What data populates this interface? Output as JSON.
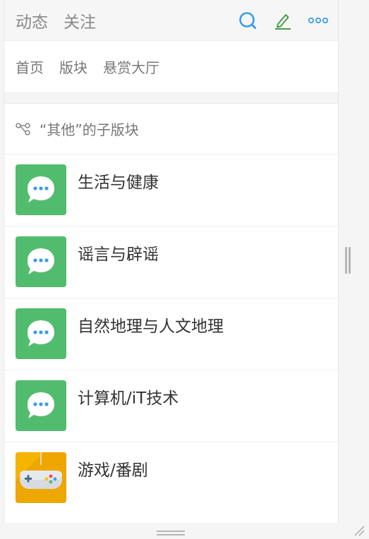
{
  "topbar": {
    "tabs": [
      "动态",
      "关注"
    ],
    "icons": [
      "search-icon",
      "edit-icon",
      "more-icon"
    ],
    "accent_blue": "#3a9ee8",
    "accent_green": "#52bc6e"
  },
  "nav": {
    "items": [
      "首页",
      "版块",
      "悬赏大厅"
    ]
  },
  "section": {
    "title": "“其他”的子版块",
    "icon": "subboard-icon"
  },
  "boards": [
    {
      "name": "生活与健康",
      "icon": "chat-bubble-icon"
    },
    {
      "name": "谣言与辟谣",
      "icon": "chat-bubble-icon"
    },
    {
      "name": "自然地理与人文地理",
      "icon": "chat-bubble-icon"
    },
    {
      "name": "计算机/iT技术",
      "icon": "chat-bubble-icon"
    },
    {
      "name": "游戏/番剧",
      "icon": "gamepad-icon"
    }
  ],
  "colors": {
    "board_icon_bg": "#52bc6e",
    "game_icon_bg": "#f5a623"
  }
}
